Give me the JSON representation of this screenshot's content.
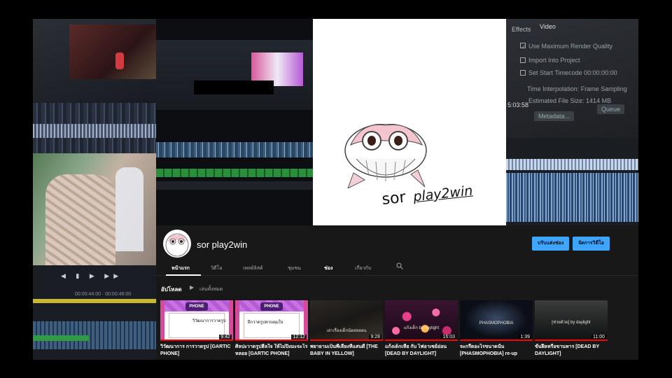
{
  "channel": {
    "name": "sor play2win",
    "logo_text": "sor",
    "logo_subtext": "play2win",
    "customize_label": "ปรับแต่งช่อง",
    "manage_label": "จัดการวิดีโอ"
  },
  "tabs": [
    {
      "label": "หน้าแรก",
      "active": true
    },
    {
      "label": "วิดีโอ",
      "active": false
    },
    {
      "label": "เพลย์ลิสต์",
      "active": false
    },
    {
      "label": "ชุมชน",
      "active": false
    },
    {
      "label": "ช่อง",
      "active": false
    },
    {
      "label": "เกี่ยวกับ",
      "active": false
    }
  ],
  "section": {
    "title": "อัปโหลด",
    "play_all": "เล่นทั้งหมด"
  },
  "videos": [
    {
      "title": "วิวัฒนาการ การวาดรูป [GARTIC PHONE]",
      "duration": "9:42",
      "thumb": "gartic",
      "caption": "วิวัฒนาการวาดรูป",
      "badge": "PHONE",
      "watched": 1.0
    },
    {
      "title": "ศิลปะวาดรูปฮีลใจ ให้ไม่ปิ่งมะจะโรหลอย [GARTIC PHONE]",
      "duration": "12:12",
      "thumb": "gartic",
      "caption": "ฝึกวาดรูปควบคุมใจ",
      "badge": "PHONE",
      "watched": 1.0
    },
    {
      "title": "พยายามเป็นพี่เลี้ยงที่แสนดี [THE BABY IN YELLOW]",
      "duration": "9:28",
      "thumb": "dark",
      "caption": "เล่าเรื่องเด็กน้อยหลอน",
      "watched": 1.0
    },
    {
      "title": "แก้งเด็กเหี้ย กับ ไฟอาเซย์อ่อน [DEAD BY DAYLIGHT]",
      "duration": "16:03",
      "thumb": "hearts",
      "caption": "แก้งเด็ก by daylight",
      "watched": 1.0
    },
    {
      "title": "จะกรี๊ดอะไรขนาดนั้น [PHASMOPHOBIA] re-up",
      "duration": "1:39",
      "thumb": "phasmo",
      "caption": "PHASMOPHOBIA",
      "watched": 1.0
    },
    {
      "title": "ขั้นฝีลหรือขานหาร [DEAD BY DAYLIGHT]",
      "duration": "11:00",
      "thumb": "dbd",
      "caption": "[ช่วยด้วย] by daylight",
      "watched": 1.0
    }
  ],
  "dialog": {
    "tabs": [
      "Effects",
      "Video"
    ],
    "use_max_quality": "Use Maximum Render Quality",
    "import_into_project": "Import Into Project",
    "set_start_timecode": "Set Start Timecode",
    "timecode": "00:00:00:00",
    "time_interpolation_label": "Time Interpolation:",
    "time_interpolation_value": "Frame Sampling",
    "estimated_size_label": "Estimated File Size:",
    "estimated_size_value": "1414 MB",
    "metadata_button": "Metadata...",
    "queue_button": "Queue",
    "side_timecode": "5:03:58"
  },
  "colors": {
    "accent": "#3ea6ff",
    "yt_bg": "#181818",
    "progress": "#ff0000"
  }
}
